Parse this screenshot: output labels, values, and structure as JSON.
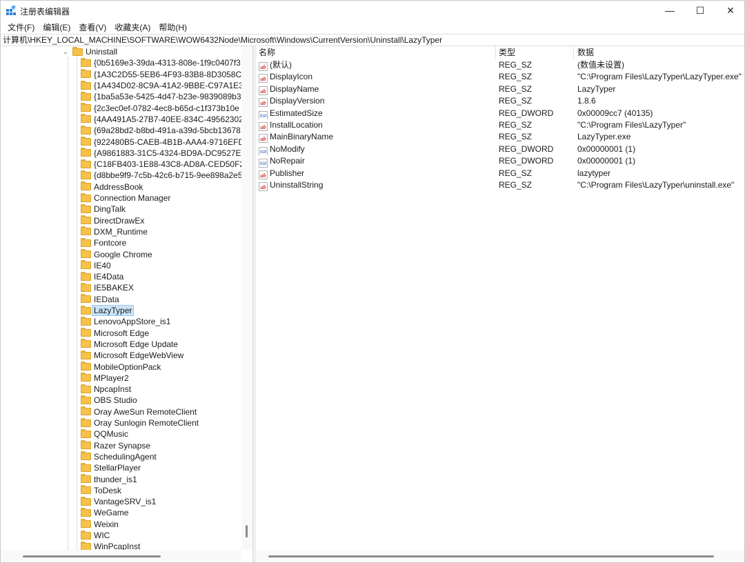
{
  "window": {
    "title": "注册表编辑器",
    "minimize_glyph": "—",
    "maximize_glyph": "☐",
    "close_glyph": "✕"
  },
  "menu": [
    {
      "label": "文件(F)"
    },
    {
      "label": "编辑(E)"
    },
    {
      "label": "查看(V)"
    },
    {
      "label": "收藏夹(A)"
    },
    {
      "label": "帮助(H)"
    }
  ],
  "address": "计算机\\HKEY_LOCAL_MACHINE\\SOFTWARE\\WOW6432Node\\Microsoft\\Windows\\CurrentVersion\\Uninstall\\LazyTyper",
  "tree": {
    "parent": {
      "label": "Uninstall",
      "expander": "⌄"
    },
    "children": [
      {
        "label": "{0b5169e3-39da-4313-808e-1f9c0407f3"
      },
      {
        "label": "{1A3C2D55-5EB6-4F93-83B8-8D3058C3"
      },
      {
        "label": "{1A434D02-8C9A-41A2-9BBE-C97A1E31"
      },
      {
        "label": "{1ba5a53e-5425-4d47-b23e-9839089b3"
      },
      {
        "label": "{2c3ec0ef-0782-4ec8-b65d-c1f373b10e"
      },
      {
        "label": "{4AA491A5-27B7-40EE-834C-49562302A"
      },
      {
        "label": "{69a28bd2-b8bd-491a-a39d-5bcb13678"
      },
      {
        "label": "{922480B5-CAEB-4B1B-AAA4-9716EFD("
      },
      {
        "label": "{A9861883-31C5-4324-BD9A-DC9527EE"
      },
      {
        "label": "{C18FB403-1E88-43C8-AD8A-CED50F23"
      },
      {
        "label": "{d8bbe9f9-7c5b-42c6-b715-9ee898a2e5"
      },
      {
        "label": "AddressBook"
      },
      {
        "label": "Connection Manager"
      },
      {
        "label": "DingTalk"
      },
      {
        "label": "DirectDrawEx"
      },
      {
        "label": "DXM_Runtime"
      },
      {
        "label": "Fontcore"
      },
      {
        "label": "Google Chrome"
      },
      {
        "label": "IE40"
      },
      {
        "label": "IE4Data"
      },
      {
        "label": "IE5BAKEX"
      },
      {
        "label": "IEData"
      },
      {
        "label": "LazyTyper",
        "selected": true
      },
      {
        "label": "LenovoAppStore_is1"
      },
      {
        "label": "Microsoft Edge"
      },
      {
        "label": "Microsoft Edge Update"
      },
      {
        "label": "Microsoft EdgeWebView"
      },
      {
        "label": "MobileOptionPack"
      },
      {
        "label": "MPlayer2"
      },
      {
        "label": "NpcapInst"
      },
      {
        "label": "OBS Studio"
      },
      {
        "label": "Oray AweSun RemoteClient"
      },
      {
        "label": "Oray Sunlogin RemoteClient"
      },
      {
        "label": "QQMusic"
      },
      {
        "label": "Razer Synapse"
      },
      {
        "label": "SchedulingAgent"
      },
      {
        "label": "StellarPlayer"
      },
      {
        "label": "thunder_is1"
      },
      {
        "label": "ToDesk"
      },
      {
        "label": "VantageSRV_is1"
      },
      {
        "label": "WeGame"
      },
      {
        "label": "Weixin"
      },
      {
        "label": "WIC"
      },
      {
        "label": "WinPcapInst"
      }
    ]
  },
  "values": {
    "headers": {
      "name": "名称",
      "type": "类型",
      "data": "数据"
    },
    "rows": [
      {
        "icon": "string-value-icon",
        "badge": "ab",
        "name": "(默认)",
        "type": "REG_SZ",
        "data": "(数值未设置)"
      },
      {
        "icon": "string-value-icon",
        "badge": "ab",
        "name": "DisplayIcon",
        "type": "REG_SZ",
        "data": "\"C:\\Program Files\\LazyTyper\\LazyTyper.exe\""
      },
      {
        "icon": "string-value-icon",
        "badge": "ab",
        "name": "DisplayName",
        "type": "REG_SZ",
        "data": "LazyTyper"
      },
      {
        "icon": "string-value-icon",
        "badge": "ab",
        "name": "DisplayVersion",
        "type": "REG_SZ",
        "data": "1.8.6"
      },
      {
        "icon": "dword-value-icon",
        "badge": "010",
        "name": "EstimatedSize",
        "type": "REG_DWORD",
        "data": "0x00009cc7 (40135)"
      },
      {
        "icon": "string-value-icon",
        "badge": "ab",
        "name": "InstallLocation",
        "type": "REG_SZ",
        "data": "\"C:\\Program Files\\LazyTyper\""
      },
      {
        "icon": "string-value-icon",
        "badge": "ab",
        "name": "MainBinaryName",
        "type": "REG_SZ",
        "data": "LazyTyper.exe"
      },
      {
        "icon": "dword-value-icon",
        "badge": "010",
        "name": "NoModify",
        "type": "REG_DWORD",
        "data": "0x00000001 (1)"
      },
      {
        "icon": "dword-value-icon",
        "badge": "010",
        "name": "NoRepair",
        "type": "REG_DWORD",
        "data": "0x00000001 (1)"
      },
      {
        "icon": "string-value-icon",
        "badge": "ab",
        "name": "Publisher",
        "type": "REG_SZ",
        "data": "lazytyper"
      },
      {
        "icon": "string-value-icon",
        "badge": "ab",
        "name": "UninstallString",
        "type": "REG_SZ",
        "data": "\"C:\\Program Files\\LazyTyper\\uninstall.exe\""
      }
    ]
  }
}
